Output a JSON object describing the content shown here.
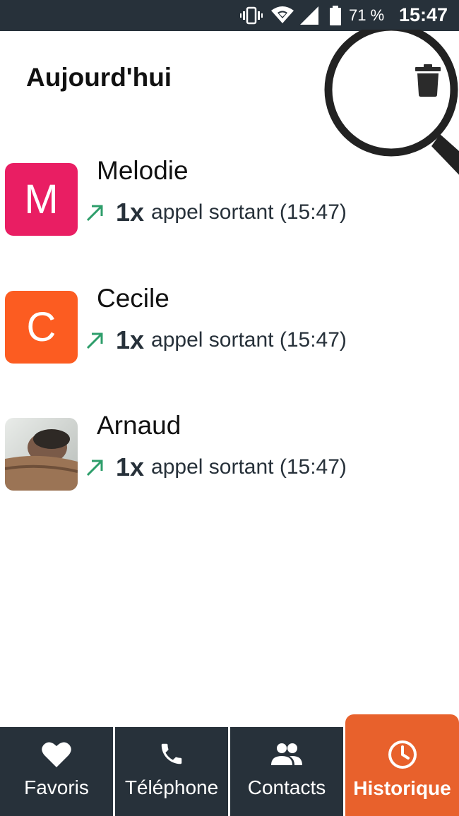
{
  "status_bar": {
    "battery_percent": "71 %",
    "time": "15:47",
    "icons": [
      "vibrate-icon",
      "wifi-icon",
      "signal-icon",
      "battery-icon"
    ]
  },
  "header": {
    "title": "Aujourd'hui",
    "trash_icon": "trash-icon"
  },
  "calls": [
    {
      "name": "Melodie",
      "avatar_letter": "M",
      "avatar_color": "#e91e63",
      "count": "1x",
      "description": "appel sortant (15:47)"
    },
    {
      "name": "Cecile",
      "avatar_letter": "C",
      "avatar_color": "#fc5c21",
      "count": "1x",
      "description": "appel sortant (15:47)"
    },
    {
      "name": "Arnaud",
      "avatar_letter": "",
      "avatar_color": "#8a8a8a",
      "count": "1x",
      "description": "appel sortant (15:47)"
    }
  ],
  "nav": {
    "tabs": [
      {
        "label": "Favoris",
        "icon": "heart-icon"
      },
      {
        "label": "Téléphone",
        "icon": "phone-icon"
      },
      {
        "label": "Contacts",
        "icon": "people-icon"
      },
      {
        "label": "Historique",
        "icon": "clock-icon",
        "active": true
      }
    ]
  },
  "colors": {
    "dark": "#27313a",
    "accent": "#e8612c",
    "outgoing_arrow": "#2e9e6b"
  }
}
